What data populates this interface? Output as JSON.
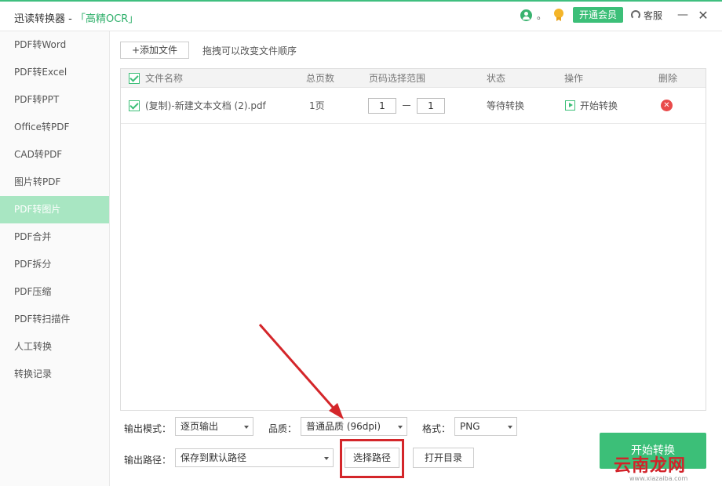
{
  "window": {
    "app_name": "迅读转换器 - ",
    "mode_tag": "「高精OCR」",
    "user_dot": "。",
    "vip_button": "开通会员",
    "service_label": "客服",
    "minimize": "—",
    "close": "✕"
  },
  "sidebar": {
    "items": [
      {
        "label": "PDF转Word"
      },
      {
        "label": "PDF转Excel"
      },
      {
        "label": "PDF转PPT"
      },
      {
        "label": "Office转PDF"
      },
      {
        "label": "CAD转PDF"
      },
      {
        "label": "图片转PDF"
      },
      {
        "label": "PDF转图片",
        "active": true
      },
      {
        "label": "PDF合并"
      },
      {
        "label": "PDF拆分"
      },
      {
        "label": "PDF压缩"
      },
      {
        "label": "PDF转扫描件"
      },
      {
        "label": "人工转换"
      },
      {
        "label": "转换记录"
      }
    ]
  },
  "toolbar": {
    "add_file_label": "+添加文件",
    "drag_hint": "拖拽可以改变文件顺序"
  },
  "table": {
    "headers": {
      "name": "文件名称",
      "pages": "总页数",
      "range": "页码选择范围",
      "status": "状态",
      "action": "操作",
      "delete": "删除"
    },
    "rows": [
      {
        "checked": true,
        "name": "(复制)-新建文本文档 (2).pdf",
        "pages": "1页",
        "range_from": "1",
        "range_to": "1",
        "status": "等待转换",
        "action": "开始转换"
      }
    ]
  },
  "options": {
    "output_mode_label": "输出模式：",
    "output_mode_value": "逐页输出",
    "quality_label": "品质：",
    "quality_value": "普通品质 (96dpi)",
    "format_label": "格式：",
    "format_value": "PNG",
    "output_path_label": "输出路径：",
    "output_path_value": "保存到默认路径",
    "choose_path_label": "选择路径",
    "open_dir_label": "打开目录"
  },
  "start_convert_label": "开始转换",
  "watermark": {
    "text": "云南龙网",
    "url": "www.xiazaiba.com"
  },
  "colors": {
    "accent": "#3cbf78",
    "sidebar_active": "#a8e6c2",
    "annotation_red": "#d4262a",
    "delete_red": "#e94a4a"
  }
}
